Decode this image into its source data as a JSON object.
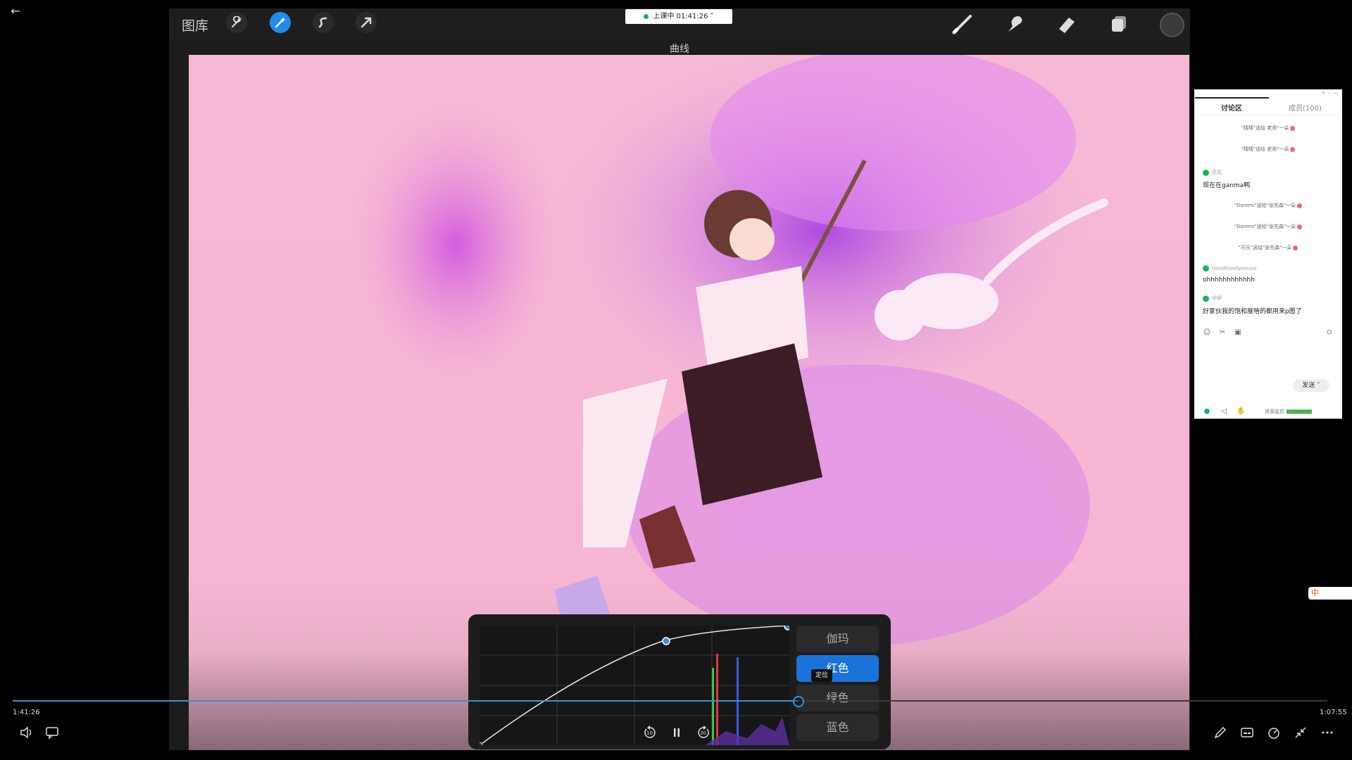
{
  "app": {
    "gallery_label": "图库",
    "status_pill": "上课中 01:41:26",
    "panel_title": "曲线"
  },
  "curves": {
    "channels": [
      "伽玛",
      "红色",
      "绿色",
      "蓝色"
    ],
    "active_channel": "红色",
    "tooltip": "定位"
  },
  "player": {
    "current_time": "1:41:26",
    "total_time": "1:07:55",
    "progress_fraction": 0.598,
    "rewind_label": "10",
    "forward_label": "30"
  },
  "chat": {
    "tab_discussion": "讨论区",
    "tab_members": "成员(100)",
    "messages": [
      {
        "type": "system",
        "text": "\"晴晴\"送给 老师\"一朵"
      },
      {
        "type": "system",
        "text": "\"晴晴\"送给 老师\"一朵"
      },
      {
        "type": "user",
        "name": "花花",
        "text": "现在在ganma鸭"
      },
      {
        "type": "system",
        "text": "\"Doremi\"送给\"张先森\"一朵"
      },
      {
        "type": "system",
        "text": "\"Doremi\"送给\"张先森\"一朵"
      },
      {
        "type": "system",
        "text": "\"可乐\"送给\"张先森\"一朵"
      },
      {
        "type": "user",
        "name": "GoodGoodyesssss",
        "text": "ohhhhhhhhhhhh"
      },
      {
        "type": "user",
        "name": "伊伊",
        "text": "好家伙我的饱和度啥的都用来p图了"
      }
    ],
    "send_label": "发送",
    "resource_monitor": "资源监控"
  },
  "ime": {
    "label": "中"
  },
  "colors": {
    "accent": "#1f8bea",
    "canvas_bg": "#f6b8d5",
    "progress": "#3a8fe0",
    "chat_online": "#19b35c"
  }
}
